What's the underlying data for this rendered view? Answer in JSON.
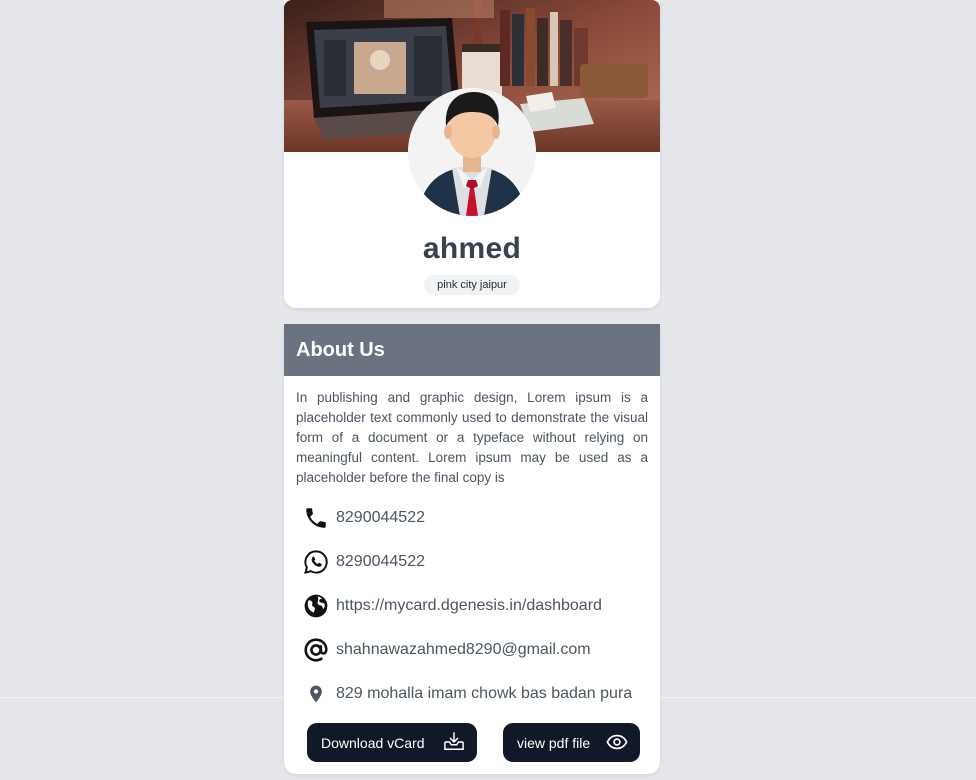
{
  "profile": {
    "name": "ahmed",
    "location": "pink city jaipur"
  },
  "about": {
    "title": "About Us",
    "text": "In publishing and graphic design, Lorem ipsum is a placeholder text commonly used to demonstrate the visual form of a document or a typeface without relying on meaningful content. Lorem ipsum may be used as a placeholder before the final copy is"
  },
  "contacts": [
    {
      "icon": "phone-icon",
      "value": "8290044522"
    },
    {
      "icon": "whatsapp-icon",
      "value": "8290044522"
    },
    {
      "icon": "globe-icon",
      "value": "https://mycard.dgenesis.in/dashboard"
    },
    {
      "icon": "at-sign-icon",
      "value": "shahnawazahmed8290@gmail.com"
    },
    {
      "icon": "location-pin-icon",
      "value": "829 mohalla imam chowk bas badan pura"
    }
  ],
  "buttons": {
    "download_vcard": "Download vCard",
    "view_pdf": "view pdf file"
  },
  "colors": {
    "background": "#e5e7eb",
    "header": "#6b7280",
    "button": "#111827",
    "name_text": "#374151",
    "tie": "#c8102e"
  }
}
